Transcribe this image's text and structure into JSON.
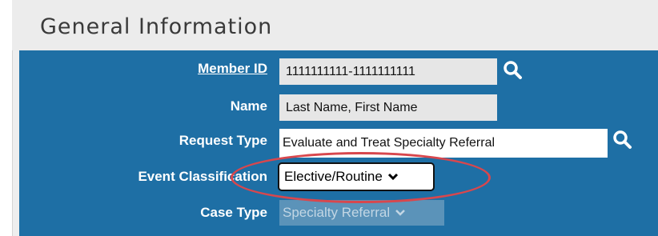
{
  "panel": {
    "title": "General Information"
  },
  "form": {
    "member_id": {
      "label": "Member ID",
      "value": "1111111111-1111111111"
    },
    "name": {
      "label": "Name",
      "value": "Last Name, First Name"
    },
    "request_type": {
      "label": "Request Type",
      "value": "Evaluate and Treat Specialty Referral"
    },
    "event_classification": {
      "label": "Event Classification",
      "value": "Elective/Routine"
    },
    "case_type": {
      "label": "Case Type",
      "value": "Specialty Referral"
    }
  },
  "icons": {
    "search": "search-icon",
    "dropdown": "chevron-down-icon"
  },
  "colors": {
    "form_background": "#1e6fa5",
    "highlight": "#d8474d",
    "header_background": "#ececec"
  }
}
